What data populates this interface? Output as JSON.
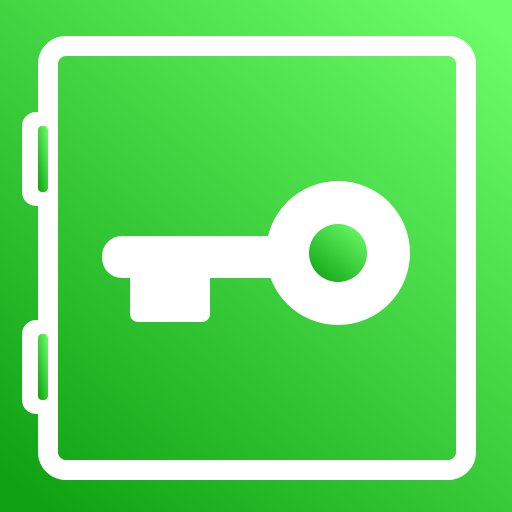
{
  "icon": {
    "name": "vault-key-icon",
    "colors": {
      "gradient_top": "#6cfc68",
      "gradient_bottom": "#0fa313",
      "foreground": "#ffffff"
    }
  }
}
